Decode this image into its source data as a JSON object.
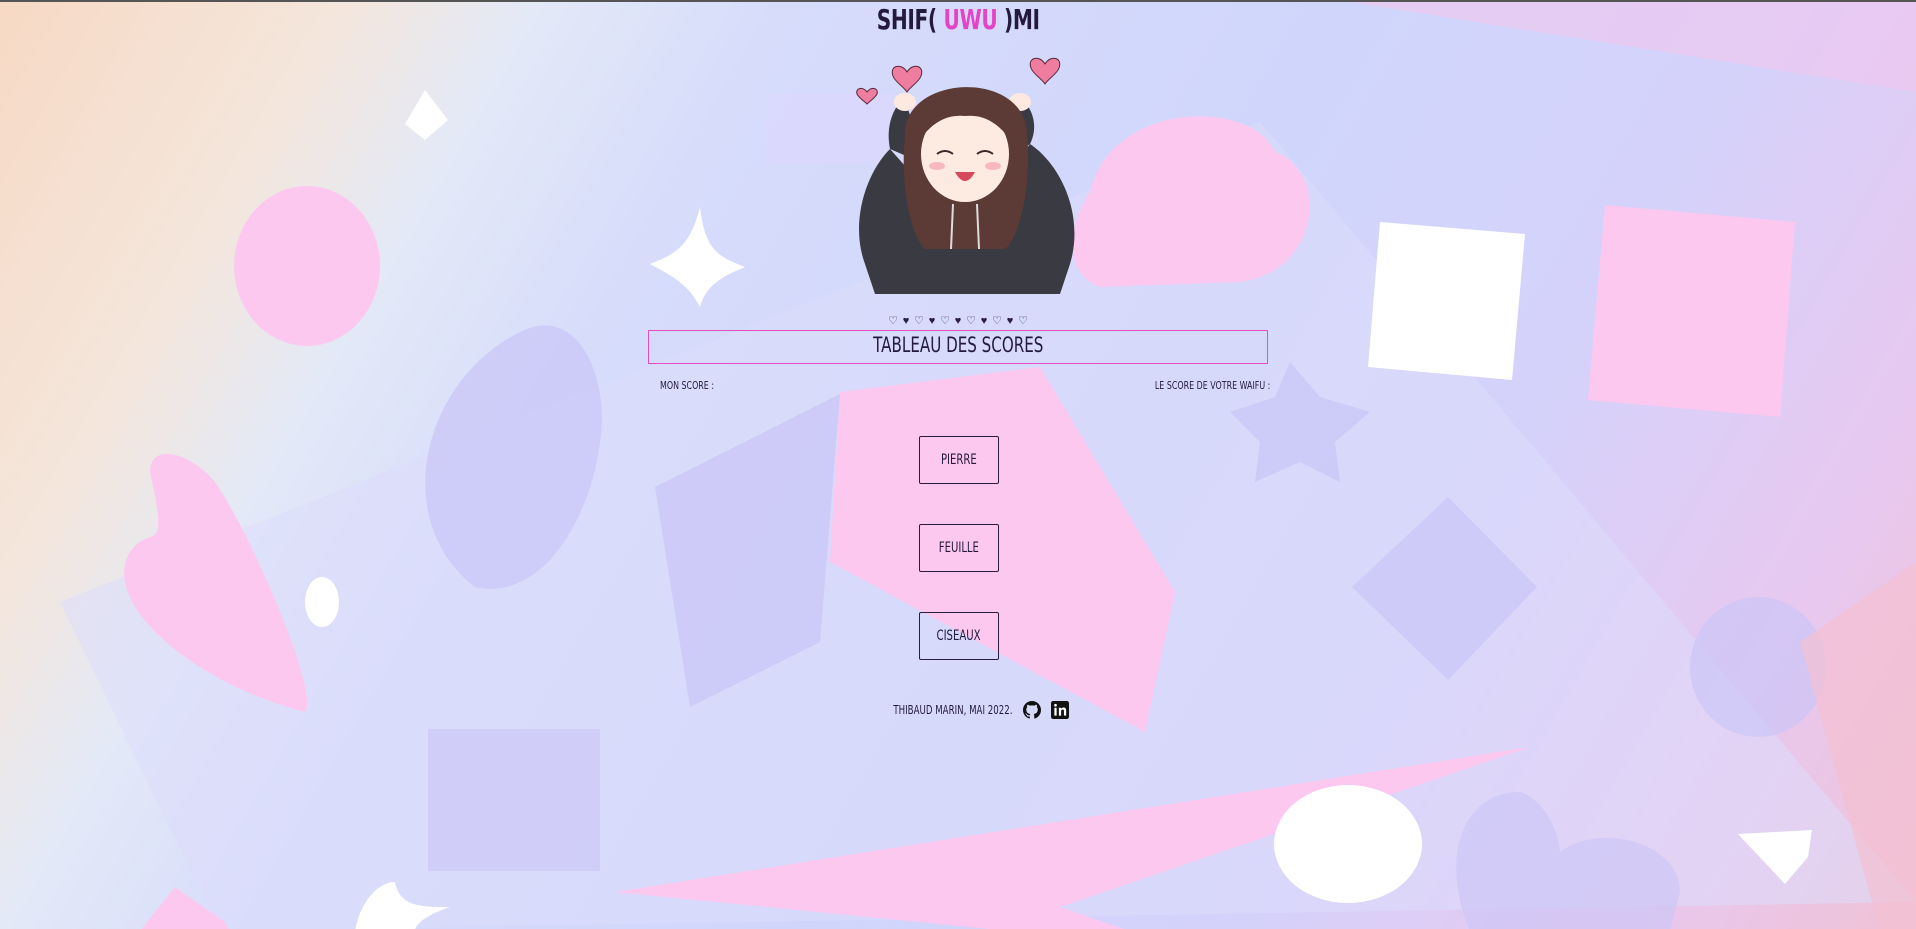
{
  "header": {
    "title_prefix": "SHIF(",
    "title_accent": "UWU",
    "title_suffix": ")MI"
  },
  "hearts": [
    "♡",
    "♥",
    "♡",
    "♥",
    "♡",
    "♥",
    "♡",
    "♥",
    "♡",
    "♥",
    "♡"
  ],
  "scoreboard": {
    "title": "TABLEAU DES SCORES",
    "my_score_label": "MON SCORE :",
    "waifu_score_label": "LE SCORE DE VOTRE WAIFU :"
  },
  "choices": {
    "rock": "PIERRE",
    "paper": "FEUILLE",
    "scissors": "CISEAUX"
  },
  "footer": {
    "credit": "THIBAUD MARIN, MAI 2022.",
    "github_icon": "github-icon",
    "linkedin_icon": "linkedin-icon"
  },
  "colors": {
    "accent": "#e542c8",
    "text": "#231a3c",
    "pink_shape": "#fdc8f0",
    "lilac_shape": "#c9c5f7"
  }
}
